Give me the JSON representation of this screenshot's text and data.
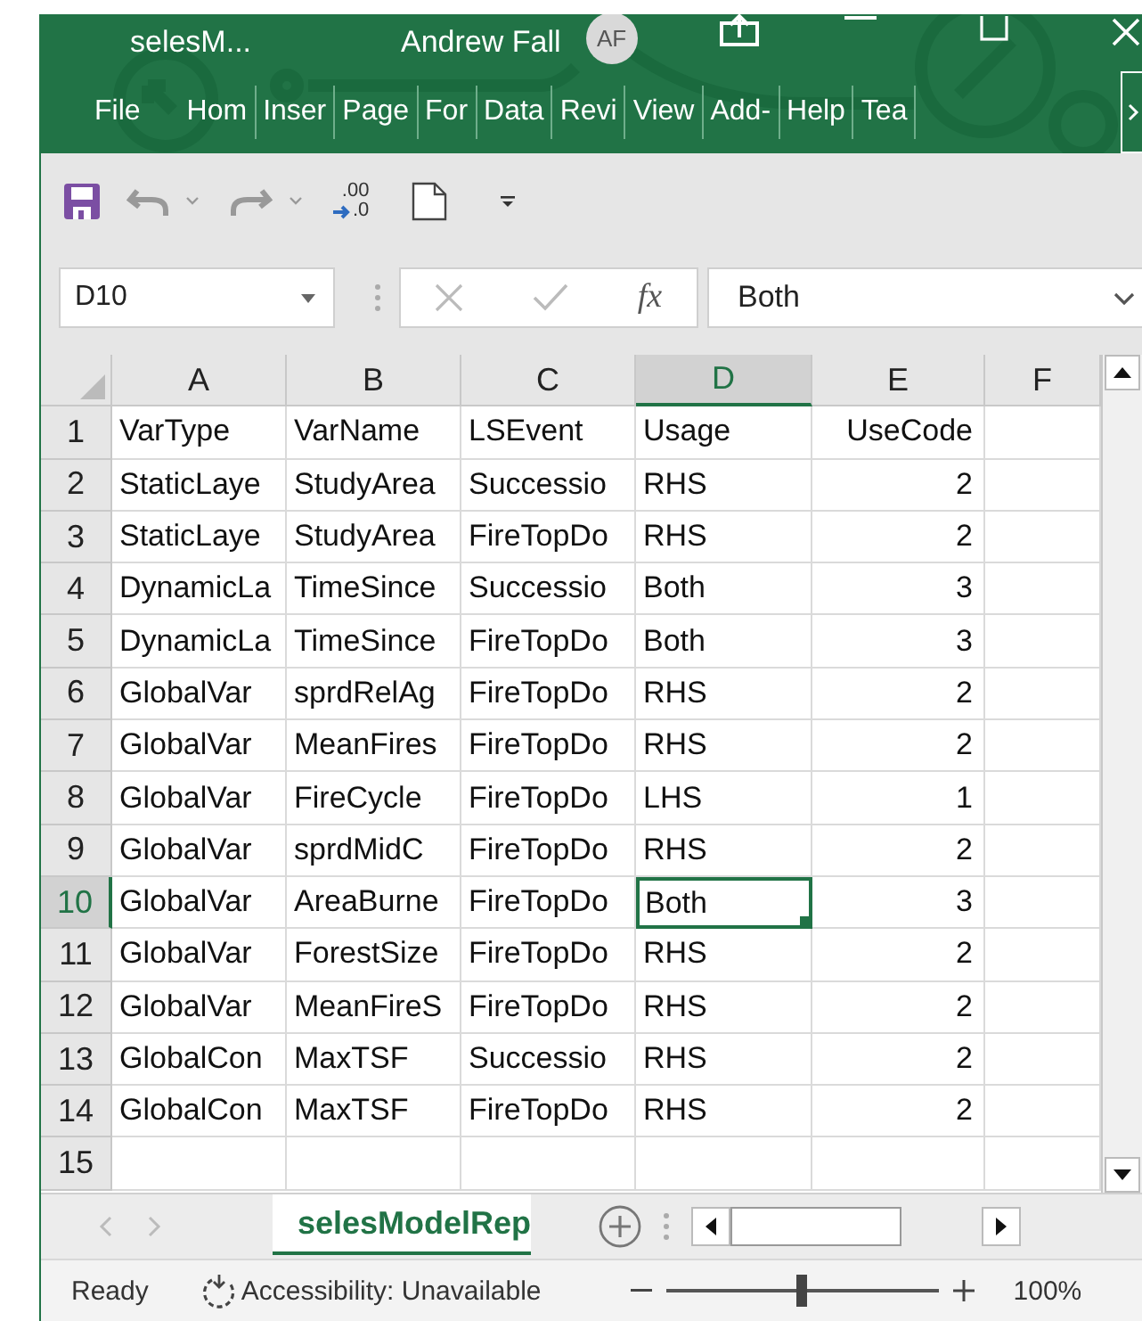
{
  "title_bar": {
    "file_name": "selesM...",
    "user_name": "Andrew Fall",
    "avatar_initials": "AF"
  },
  "ribbon_tabs": [
    {
      "label": "File"
    },
    {
      "label": "Hom"
    },
    {
      "label": "Inser"
    },
    {
      "label": "Page"
    },
    {
      "label": "For"
    },
    {
      "label": "Data"
    },
    {
      "label": "Revi"
    },
    {
      "label": "View"
    },
    {
      "label": "Add-"
    },
    {
      "label": "Help"
    },
    {
      "label": "Tea"
    }
  ],
  "quick_access": {
    "decrease_decimal_top": ".00",
    "decrease_decimal_bottom": ".0"
  },
  "formula_bar": {
    "name_box": "D10",
    "function_label": "fx",
    "value": "Both"
  },
  "columns": [
    {
      "label": "A",
      "kind": "text",
      "selected": false
    },
    {
      "label": "B",
      "kind": "text",
      "selected": false
    },
    {
      "label": "C",
      "kind": "text",
      "selected": false
    },
    {
      "label": "D",
      "kind": "text",
      "selected": true
    },
    {
      "label": "E",
      "kind": "number",
      "selected": false
    },
    {
      "label": "F",
      "kind": "text",
      "selected": false
    }
  ],
  "rows": [
    {
      "number": "1",
      "selected": false,
      "cells": [
        "VarType",
        "VarName",
        "LSEvent",
        "Usage",
        "UseCode"
      ]
    },
    {
      "number": "2",
      "selected": false,
      "cells": [
        "StaticLaye",
        "StudyArea",
        "Successio",
        "RHS",
        "2"
      ]
    },
    {
      "number": "3",
      "selected": false,
      "cells": [
        "StaticLaye",
        "StudyArea",
        "FireTopDo",
        "RHS",
        "2"
      ]
    },
    {
      "number": "4",
      "selected": false,
      "cells": [
        "DynamicLa",
        "TimeSince",
        "Successio",
        "Both",
        "3"
      ]
    },
    {
      "number": "5",
      "selected": false,
      "cells": [
        "DynamicLa",
        "TimeSince",
        "FireTopDo",
        "Both",
        "3"
      ]
    },
    {
      "number": "6",
      "selected": false,
      "cells": [
        "GlobalVar",
        "sprdRelAg",
        "FireTopDo",
        "RHS",
        "2"
      ]
    },
    {
      "number": "7",
      "selected": false,
      "cells": [
        "GlobalVar",
        "MeanFires",
        "FireTopDo",
        "RHS",
        "2"
      ]
    },
    {
      "number": "8",
      "selected": false,
      "cells": [
        "GlobalVar",
        "FireCycle",
        "FireTopDo",
        "LHS",
        "1"
      ]
    },
    {
      "number": "9",
      "selected": false,
      "cells": [
        "GlobalVar",
        "sprdMidC",
        "FireTopDo",
        "RHS",
        "2"
      ]
    },
    {
      "number": "10",
      "selected": true,
      "cells": [
        "GlobalVar",
        "AreaBurne",
        "FireTopDo",
        "Both",
        "3"
      ]
    },
    {
      "number": "11",
      "selected": false,
      "cells": [
        "GlobalVar",
        "ForestSize",
        "FireTopDo",
        "RHS",
        "2"
      ]
    },
    {
      "number": "12",
      "selected": false,
      "cells": [
        "GlobalVar",
        "MeanFireS",
        "FireTopDo",
        "RHS",
        "2"
      ]
    },
    {
      "number": "13",
      "selected": false,
      "cells": [
        "GlobalCon",
        "MaxTSF",
        "Successio",
        "RHS",
        "2"
      ]
    },
    {
      "number": "14",
      "selected": false,
      "cells": [
        "GlobalCon",
        "MaxTSF",
        "FireTopDo",
        "RHS",
        "2"
      ]
    },
    {
      "number": "15",
      "selected": false,
      "cells": []
    }
  ],
  "sheet_tabs": [
    {
      "label": "selesModelRep",
      "selected": true
    }
  ],
  "status_bar": {
    "status": "Ready",
    "accessibility": "Accessibility: Unavailable",
    "zoom_slider": {
      "level": 0.5
    },
    "zoom_percent": "100%"
  }
}
